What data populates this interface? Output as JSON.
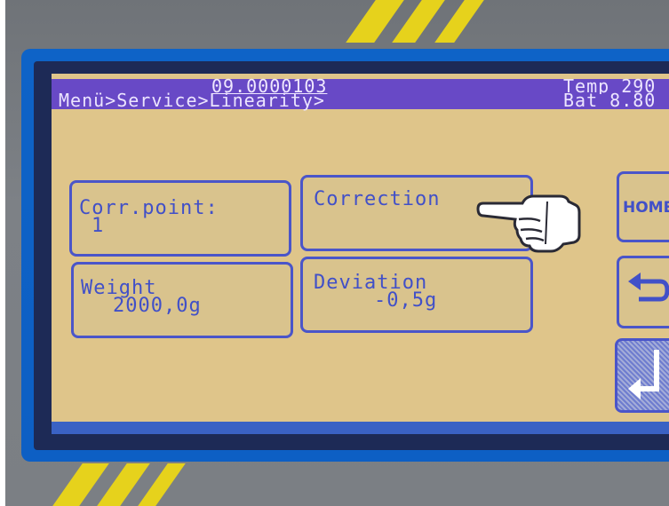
{
  "header": {
    "serial": "09.0000103",
    "temp": "Temp 290",
    "breadcrumb": "Menü>Service>Linearity>",
    "battery": "Bat 8.80"
  },
  "tiles": {
    "corr_point": {
      "label": "Corr.point:",
      "value": "1"
    },
    "correction": {
      "label": "Correction"
    },
    "weight": {
      "label": "Weight",
      "value": "2000,0g"
    },
    "deviation": {
      "label": "Deviation",
      "value": "-0,5g"
    }
  },
  "buttons": {
    "home": "HOME",
    "back_icon": "return-arrow-icon",
    "enter_icon": "enter-arrow-icon"
  },
  "colors": {
    "lcd_background": "#dfc58a",
    "header_bar": "#6849c6",
    "lcd_text": "#4150c8",
    "bezel": "#0e63c7"
  }
}
